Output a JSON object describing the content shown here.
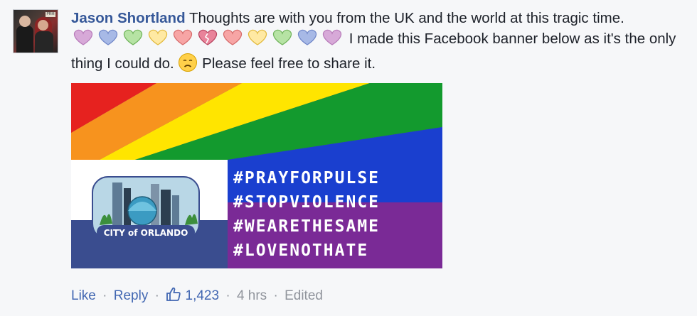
{
  "comment": {
    "author": "Jason Shortland",
    "text_1": "Thoughts are with you from the UK and the world at this tragic time.",
    "text_2": "I made this Facebook banner below as it's the only thing I could do.",
    "text_3": "Please feel free to share it.",
    "hearts": [
      "purple-heart",
      "blue-heart",
      "green-heart",
      "yellow-heart",
      "red-heart",
      "broken-heart",
      "red-heart",
      "yellow-heart",
      "green-heart",
      "blue-heart",
      "purple-heart"
    ],
    "sad_emoji": "sad-face-emoji"
  },
  "banner": {
    "hashtags": [
      "#PRAYFORPULSE",
      "#STOPVIOLENCE",
      "#WEARETHESAME",
      "#LOVENOTHATE"
    ],
    "city_label": "CITY of ORLANDO",
    "colors": {
      "red": "#e6221f",
      "orange": "#f7931e",
      "yellow": "#ffe500",
      "green": "#139a2e",
      "blue": "#1a3fcf",
      "purple": "#7a2a96",
      "flag_blue": "#3a4d8f",
      "flag_red": "#c52a2a"
    }
  },
  "actions": {
    "like": "Like",
    "reply": "Reply",
    "like_count": "1,423",
    "time": "4 hrs",
    "edited": "Edited"
  },
  "colors": {
    "author_blue": "#365899",
    "link_blue": "#4267b2",
    "meta_gray": "#90949c",
    "background": "#f6f7f9"
  }
}
